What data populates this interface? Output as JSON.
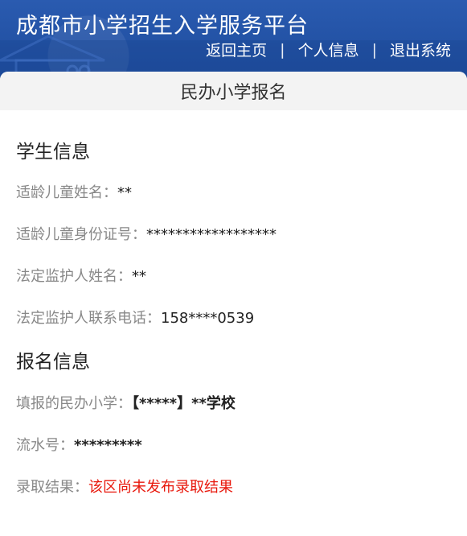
{
  "header": {
    "title": "成都市小学招生入学服务平台",
    "nav": [
      {
        "label": "返回主页"
      },
      {
        "label": "个人信息"
      },
      {
        "label": "退出系统"
      }
    ],
    "separator": "|",
    "background_color": "#1f4fa0"
  },
  "page_title": "民办小学报名",
  "student_section": {
    "title": "学生信息",
    "fields": [
      {
        "label": "适龄儿童姓名：",
        "value": "**"
      },
      {
        "label": "适龄儿童身份证号：",
        "value": "******************"
      },
      {
        "label": "法定监护人姓名：",
        "value": "**"
      },
      {
        "label": "法定监护人联系电话：",
        "value": "158****0539"
      }
    ]
  },
  "registration_section": {
    "title": "报名信息",
    "fields": [
      {
        "label": "填报的民办小学：",
        "value": "【*****】**学校"
      },
      {
        "label": "流水号：",
        "value": "*********"
      },
      {
        "label": "录取结果：",
        "value": "该区尚未发布录取结果"
      }
    ]
  },
  "colors": {
    "label": "#888888",
    "value": "#222222",
    "result": "#e8180c",
    "title_bar": "#f3f3f3"
  }
}
